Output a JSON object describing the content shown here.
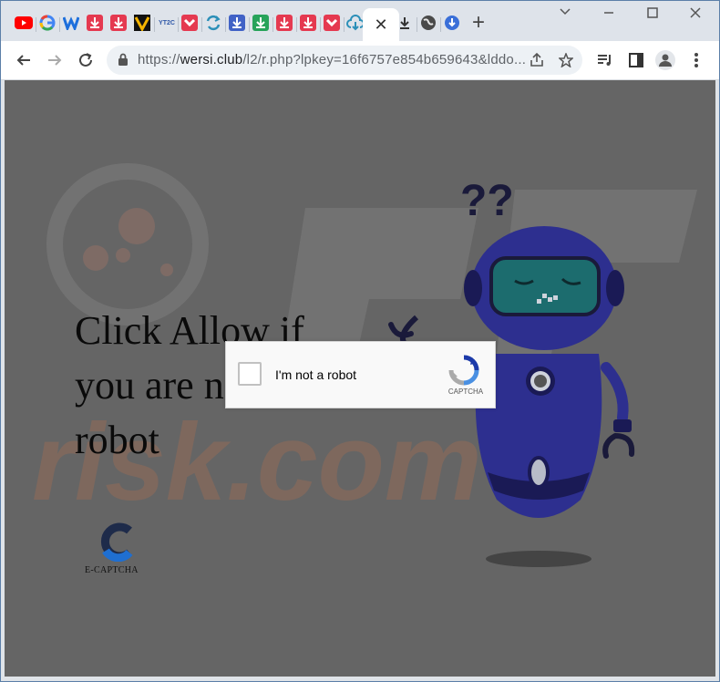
{
  "browser": {
    "tabs": [
      {
        "icon": "youtube-icon",
        "color": "#ff0000"
      },
      {
        "icon": "google-icon",
        "color": "#ffffff"
      },
      {
        "icon": "w-icon",
        "color": "#ffffff"
      },
      {
        "icon": "download-icon",
        "color": "#e53950"
      },
      {
        "icon": "download-icon",
        "color": "#e53950"
      },
      {
        "icon": "v-logo-icon",
        "color": "#111111"
      },
      {
        "icon": "yt2c-icon",
        "label": "YT2C",
        "color": "#ffffff"
      },
      {
        "icon": "download-icon",
        "color": "#e53950"
      },
      {
        "icon": "swap-icon",
        "color": "#ffffff"
      },
      {
        "icon": "download-icon",
        "color": "#4162c6"
      },
      {
        "icon": "download-icon",
        "color": "#27a35a"
      },
      {
        "icon": "download-icon",
        "color": "#e53950"
      },
      {
        "icon": "download-icon",
        "color": "#e53950"
      },
      {
        "icon": "download-icon",
        "color": "#e53950"
      },
      {
        "icon": "cloud-download-icon",
        "color": "#ffffff"
      },
      {
        "icon": "close-icon",
        "color": "#ffffff"
      },
      {
        "icon": "download-arrow-icon",
        "color": "#ffffff"
      },
      {
        "icon": "globe-icon",
        "color": "#ffffff"
      },
      {
        "icon": "download-circle-icon",
        "color": "#3a6fd8"
      }
    ],
    "active_tab_close": "✕",
    "new_tab": "+",
    "window": {
      "minimize": "⌄",
      "restore": "—",
      "maximize": "☐",
      "close": "✕"
    },
    "url": {
      "scheme": "https://",
      "host": "wersi.club",
      "path": "/l2/r.php?lpkey=16f6757e854b659643&lddo..."
    }
  },
  "page": {
    "headline": [
      "Click Allow if",
      "you are not a",
      "robot"
    ],
    "logo_text": "E-CAPTCHA",
    "captcha": {
      "label": "I'm not a robot",
      "brand": "CAPTCHA"
    },
    "robot_question": "??"
  },
  "colors": {
    "overlay": "#656565",
    "robot_body": "#2d2f8f",
    "robot_visor": "#1c6c6e"
  }
}
